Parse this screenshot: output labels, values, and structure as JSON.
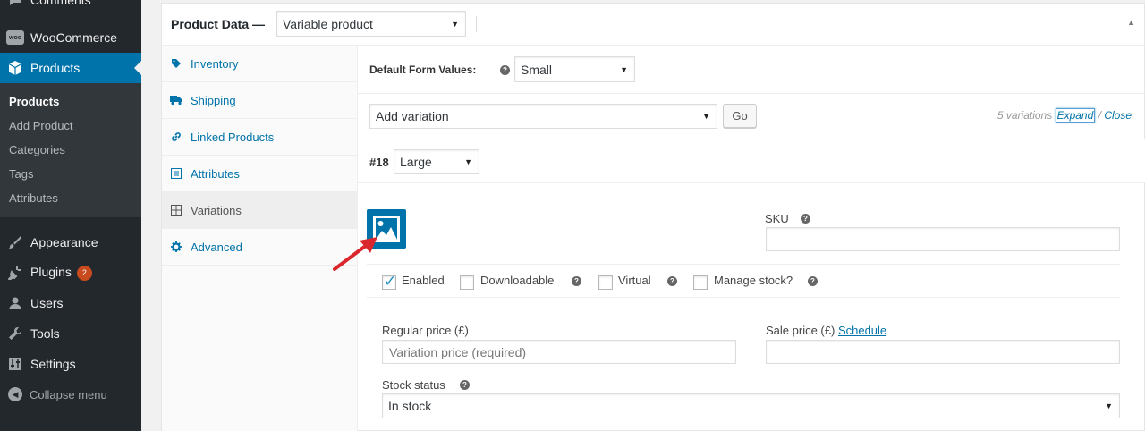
{
  "sidebar": {
    "comments_label": "Comments",
    "woocommerce_label": "WooCommerce",
    "woo_logo_text": "woo",
    "products_label": "Products",
    "submenu": [
      "Products",
      "Add Product",
      "Categories",
      "Tags",
      "Attributes"
    ],
    "appearance_label": "Appearance",
    "plugins_label": "Plugins",
    "plugins_badge": "2",
    "users_label": "Users",
    "tools_label": "Tools",
    "settings_label": "Settings",
    "collapse_label": "Collapse menu"
  },
  "product_data": {
    "title": "Product Data —",
    "product_type": "Variable product"
  },
  "tabs": [
    {
      "label": "Inventory",
      "icon": "tag-icon"
    },
    {
      "label": "Shipping",
      "icon": "truck-icon"
    },
    {
      "label": "Linked Products",
      "icon": "link-icon"
    },
    {
      "label": "Attributes",
      "icon": "list-icon"
    },
    {
      "label": "Variations",
      "icon": "grid-icon"
    },
    {
      "label": "Advanced",
      "icon": "gear-icon"
    }
  ],
  "defaults": {
    "label": "Default Form Values:",
    "value": "Small"
  },
  "variation_toolbar": {
    "action": "Add variation",
    "go_label": "Go",
    "count_text": "5 variations",
    "expand_label": "Expand",
    "slash": "/",
    "close_label": "Close"
  },
  "variation": {
    "id_label": "#18",
    "size": "Large",
    "sku_label": "SKU",
    "sku_value": "",
    "enabled_label": "Enabled",
    "enabled_checked": true,
    "downloadable_label": "Downloadable",
    "virtual_label": "Virtual",
    "manage_stock_label": "Manage stock?",
    "regular_price_label": "Regular price (£)",
    "regular_price_placeholder": "Variation price (required)",
    "sale_price_label": "Sale price (£)",
    "schedule_label": "Schedule",
    "stock_status_label": "Stock status",
    "stock_status_value": "In stock"
  },
  "colors": {
    "wp_blue": "#0073aa",
    "sidebar_bg": "#23282d",
    "arrow_red": "#d9272d"
  }
}
